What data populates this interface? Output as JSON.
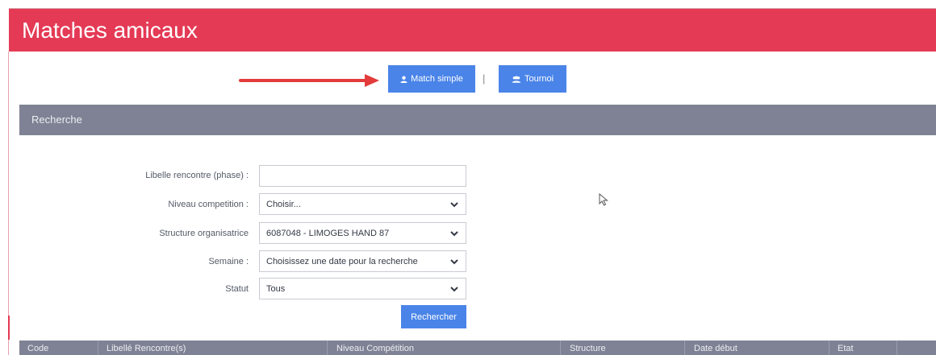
{
  "header": {
    "title": "Matches amicaux",
    "color": "#e43a55"
  },
  "actions": {
    "match_simple_label": "Match simple",
    "separator": "|",
    "tournoi_label": "Tournoi"
  },
  "panel": {
    "title": "Recherche"
  },
  "form": {
    "libelle_label": "Libelle rencontre (phase) :",
    "libelle_value": "",
    "niveau_label": "Niveau competition :",
    "niveau_value": "Choisir...",
    "structure_label": "Structure organisatrice",
    "structure_value": "6087048 - LIMOGES HAND 87",
    "semaine_label": "Semaine :",
    "semaine_value": "Choisissez une date pour la recherche",
    "statut_label": "Statut",
    "statut_value": "Tous",
    "search_button": "Rechercher"
  },
  "table": {
    "columns": [
      "Code",
      "Libellé Rencontre(s)",
      "Niveau Compétition",
      "Structure",
      "Date début",
      "Etat"
    ]
  },
  "icons": {
    "match_simple": "user-icon",
    "tournoi": "users-icon",
    "dropdown": "chevron-down-icon",
    "pointer": "mouse-cursor-icon",
    "annotation": "red-arrow"
  }
}
